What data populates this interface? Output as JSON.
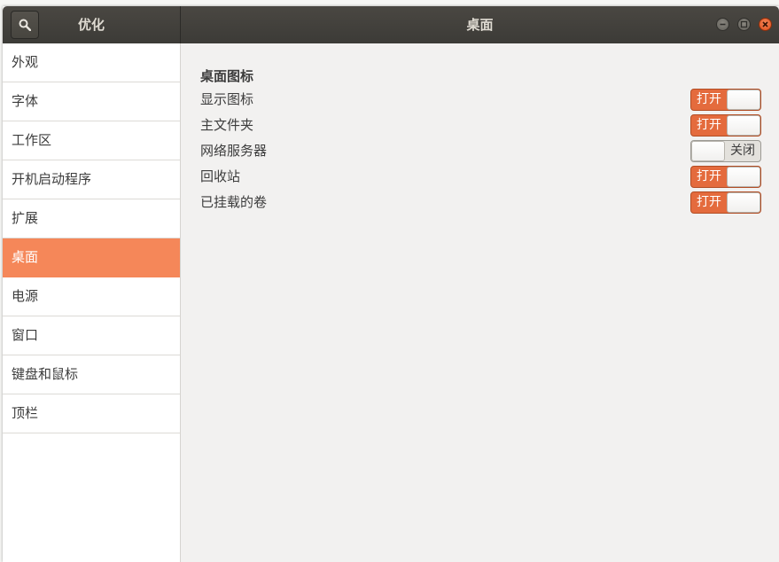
{
  "window": {
    "app_title": "优化",
    "page_title": "桌面"
  },
  "icons": {
    "search": "search-icon",
    "minimize": "minimize-icon",
    "maximize": "maximize-icon",
    "close": "close-icon"
  },
  "colors": {
    "accent": "#f58759",
    "switch_on": "#e46b3d",
    "titlebar": "#3c3b37"
  },
  "sidebar": {
    "items": [
      {
        "label": "外观",
        "active": false
      },
      {
        "label": "字体",
        "active": false
      },
      {
        "label": "工作区",
        "active": false
      },
      {
        "label": "开机启动程序",
        "active": false
      },
      {
        "label": "扩展",
        "active": false
      },
      {
        "label": "桌面",
        "active": true
      },
      {
        "label": "电源",
        "active": false
      },
      {
        "label": "窗口",
        "active": false
      },
      {
        "label": "键盘和鼠标",
        "active": false
      },
      {
        "label": "顶栏",
        "active": false
      }
    ]
  },
  "main": {
    "section_title": "桌面图标",
    "settings": [
      {
        "label": "显示图标",
        "state": "on",
        "state_label": "打开"
      },
      {
        "label": "主文件夹",
        "state": "on",
        "state_label": "打开"
      },
      {
        "label": "网络服务器",
        "state": "off",
        "state_label": "关闭"
      },
      {
        "label": "回收站",
        "state": "on",
        "state_label": "打开"
      },
      {
        "label": "已挂载的卷",
        "state": "on",
        "state_label": "打开"
      }
    ]
  }
}
